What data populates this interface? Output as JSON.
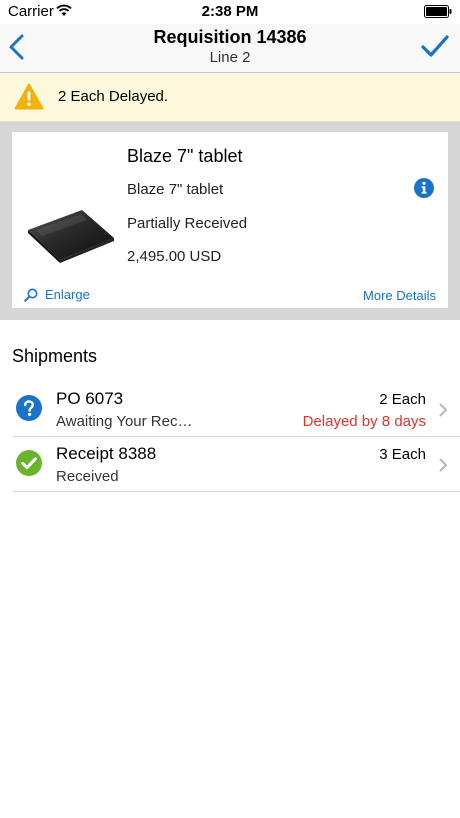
{
  "status_bar": {
    "carrier": "Carrier",
    "time": "2:38 PM"
  },
  "nav": {
    "title": "Requisition 14386",
    "subtitle": "Line 2"
  },
  "alert": {
    "text": "2 Each Delayed."
  },
  "item": {
    "name": "Blaze 7\" tablet",
    "description": "Blaze 7\" tablet",
    "status": "Partially Received",
    "price": "2,495.00 USD",
    "enlarge_label": "Enlarge",
    "more_label": "More Details"
  },
  "shipments": {
    "title": "Shipments",
    "rows": [
      {
        "title": "PO 6073",
        "subtitle": "Awaiting Your Rec…",
        "qty": "2 Each",
        "delay": "Delayed by 8 days",
        "icon": "question-icon"
      },
      {
        "title": "Receipt 8388",
        "subtitle": "Received",
        "qty": "3 Each",
        "delay": "",
        "icon": "check-icon"
      }
    ]
  },
  "colors": {
    "accent": "#1a73c8",
    "alert_bg": "#fbf8dc",
    "warning": "#f2b10f",
    "delay": "#e0322b",
    "success": "#6ab42d"
  }
}
